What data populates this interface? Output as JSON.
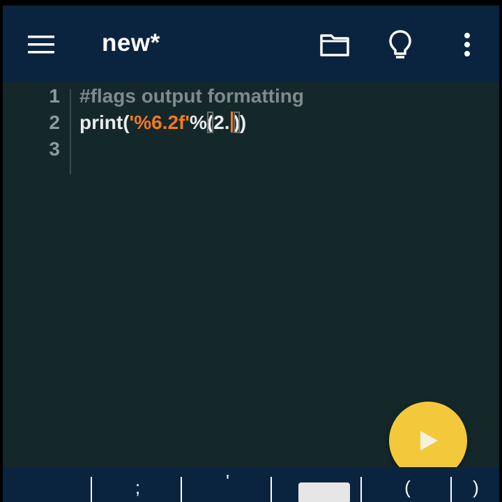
{
  "app": {
    "title": "new*"
  },
  "toolbar": {
    "icons": [
      "menu-icon",
      "folder-icon",
      "lightbulb-icon",
      "more-vert-icon"
    ]
  },
  "editor": {
    "line_numbers": [
      "1",
      "2",
      "3"
    ],
    "line1": "#flags output formatting",
    "line2": {
      "part_print": "print(",
      "part_string": "'%6.2f'",
      "part_percent": "%",
      "part_open": "(",
      "part_value": "2.",
      "part_close_inner": ")",
      "part_close_outer": ")"
    },
    "line3": ""
  },
  "fab": {
    "icon": "play-icon",
    "color": "#f3c93b"
  },
  "keybar": {
    "keys": [
      "",
      ";",
      "'",
      "",
      "(",
      ")"
    ]
  },
  "colors": {
    "appbar": "#0a2440",
    "editor_bg": "#14282a",
    "string": "#f07a25",
    "comment": "#7f8b8b"
  }
}
